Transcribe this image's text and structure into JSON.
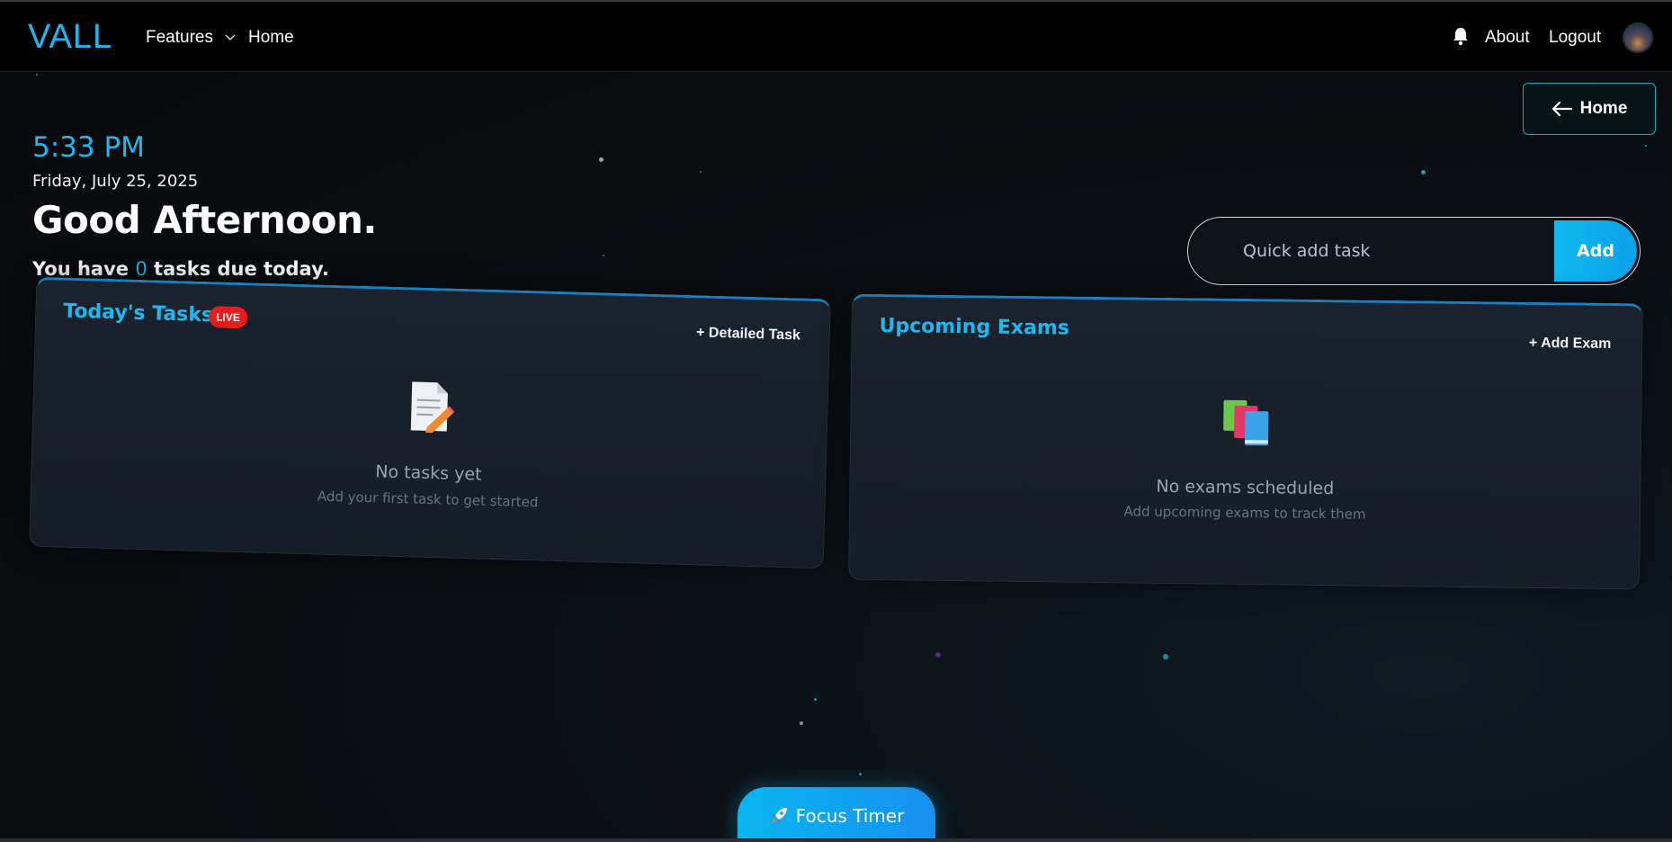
{
  "nav": {
    "logo": "VALL",
    "features": "Features",
    "home": "Home",
    "about": "About",
    "logout": "Logout"
  },
  "home_button": {
    "label": "Home"
  },
  "greeting": {
    "time": "5:33 PM",
    "date": "Friday, July 25, 2025",
    "message": "Good Afternoon.",
    "due_prefix": "You have",
    "due_count": "0",
    "due_suffix": "tasks due today."
  },
  "quick_add": {
    "placeholder": "Quick add task",
    "button": "Add"
  },
  "tasks_card": {
    "title": "Today's Tasks",
    "badge": "LIVE",
    "action": "+ Detailed Task",
    "empty_title": "No tasks yet",
    "empty_sub": "Add your first task to get started",
    "icon": "memo-icon"
  },
  "exams_card": {
    "title": "Upcoming Exams",
    "action": "+ Add Exam",
    "empty_title": "No exams scheduled",
    "empty_sub": "Add upcoming exams to track them",
    "icon": "books-icon"
  },
  "focus_timer": {
    "label": "Focus Timer",
    "icon": "rocket-icon"
  },
  "colors": {
    "accent": "#1eb8f0",
    "live": "#e81c1c",
    "bg": "#0b0f13"
  }
}
